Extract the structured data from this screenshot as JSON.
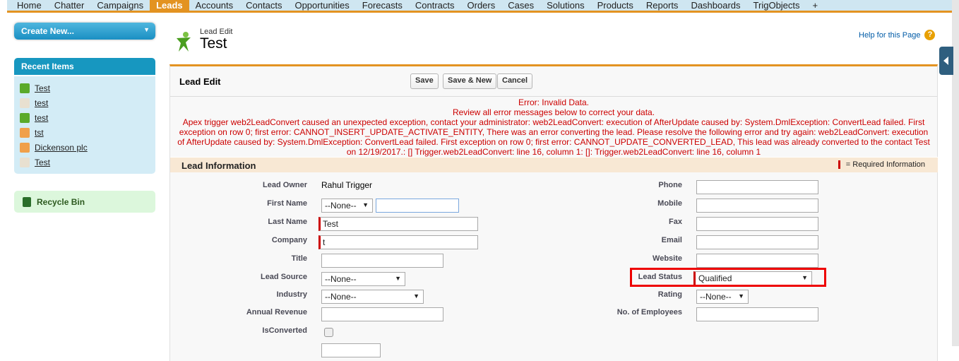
{
  "nav_tabs": [
    "Home",
    "Chatter",
    "Campaigns",
    "Leads",
    "Accounts",
    "Contacts",
    "Opportunities",
    "Forecasts",
    "Contracts",
    "Orders",
    "Cases",
    "Solutions",
    "Products",
    "Reports",
    "Dashboards",
    "TrigObjects",
    "+"
  ],
  "active_tab": "Leads",
  "sidebar": {
    "create_new": "Create New...",
    "recent_title": "Recent Items",
    "recent_items": [
      {
        "label": "Test",
        "icon": "lead-icon"
      },
      {
        "label": "test",
        "icon": "contact-icon"
      },
      {
        "label": "test",
        "icon": "lead-icon"
      },
      {
        "label": "tst",
        "icon": "account-icon"
      },
      {
        "label": "Dickenson plc",
        "icon": "account-icon"
      },
      {
        "label": "Test",
        "icon": "contact-icon"
      }
    ],
    "recycle_bin": "Recycle Bin"
  },
  "header": {
    "subtitle": "Lead Edit",
    "title": "Test",
    "help": "Help for this Page",
    "help_icon": "?"
  },
  "panel": {
    "title": "Lead Edit",
    "save": "Save",
    "save_new": "Save & New",
    "cancel": "Cancel"
  },
  "errors": [
    "Error: Invalid Data.",
    "Review all error messages below to correct your data.",
    "Apex trigger web2LeadConvert caused an unexpected exception, contact your administrator: web2LeadConvert: execution of AfterUpdate caused by: System.DmlException: ConvertLead failed. First exception on row 0; first error: CANNOT_INSERT_UPDATE_ACTIVATE_ENTITY, There was an error converting the lead. Please resolve the following error and try again: web2LeadConvert: execution of AfterUpdate caused by: System.DmlException: ConvertLead failed. First exception on row 0; first error: CANNOT_UPDATE_CONVERTED_LEAD, This lead was already converted to the contact Test on 12/19/2017.: [] Trigger.web2LeadConvert: line 16, column 1: []: Trigger.web2LeadConvert: line 16, column 1"
  ],
  "section": {
    "title": "Lead Information",
    "required_note": "= Required Information"
  },
  "fields": {
    "lead_owner": {
      "label": "Lead Owner",
      "value": "Rahul Trigger"
    },
    "first_name": {
      "label": "First Name",
      "salutation": "--None--",
      "value": ""
    },
    "last_name": {
      "label": "Last Name",
      "value": "Test"
    },
    "company": {
      "label": "Company",
      "value": "t"
    },
    "title": {
      "label": "Title",
      "value": ""
    },
    "lead_source": {
      "label": "Lead Source",
      "value": "--None--"
    },
    "industry": {
      "label": "Industry",
      "value": "--None--"
    },
    "annual_revenue": {
      "label": "Annual Revenue",
      "value": ""
    },
    "is_converted": {
      "label": "IsConverted",
      "checked": false
    },
    "phone": {
      "label": "Phone",
      "value": ""
    },
    "mobile": {
      "label": "Mobile",
      "value": ""
    },
    "fax": {
      "label": "Fax",
      "value": ""
    },
    "email": {
      "label": "Email",
      "value": ""
    },
    "website": {
      "label": "Website",
      "value": ""
    },
    "lead_status": {
      "label": "Lead Status",
      "value": "Qualified"
    },
    "rating": {
      "label": "Rating",
      "value": "--None--"
    },
    "employees": {
      "label": "No. of Employees",
      "value": ""
    }
  },
  "colors": {
    "accent": "#e39321",
    "error": "#cc0000",
    "sidebar_header": "#1797c0"
  }
}
